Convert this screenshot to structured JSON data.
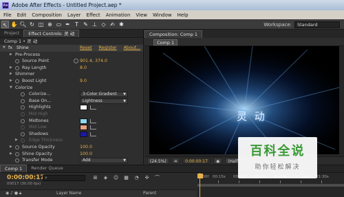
{
  "window": {
    "title": "Adobe After Effects - Untitled Project.aep *",
    "app_icon_label": "Ae"
  },
  "menu": [
    "File",
    "Edit",
    "Composition",
    "Layer",
    "Effect",
    "Animation",
    "View",
    "Window",
    "Help"
  ],
  "toolbar": {
    "tools": [
      "selection-tool",
      "hand-tool",
      "zoom-tool",
      "rotate-tool",
      "camera-tool",
      "pan-behind-tool",
      "mask-tool",
      "pen-tool",
      "text-tool",
      "brush-tool",
      "clone-tool",
      "eraser-tool",
      "roto-brush-tool",
      "puppet-tool"
    ],
    "workspace_label": "Workspace:",
    "workspace_value": "Standard"
  },
  "left_panel": {
    "tabs": [
      "Project",
      "Effect Controls: 灵 动"
    ],
    "subheader": "Comp 1 • 灵 动",
    "effect": {
      "name": "Shine",
      "links": [
        "Reset",
        "Register",
        "About..."
      ]
    },
    "rows": [
      {
        "label": "Pre-Process",
        "value": ""
      },
      {
        "label": "Source Point",
        "value": "901.4, 374.0"
      },
      {
        "label": "Ray Length",
        "value": "8.0"
      },
      {
        "label": "Shimmer",
        "value": ""
      },
      {
        "label": "Boost Light",
        "value": "9.0"
      },
      {
        "label": "Colorize",
        "value": ""
      },
      {
        "label": "Colorize...",
        "value": "3-Color Gradient"
      },
      {
        "label": "Base On...",
        "value": "Lightness"
      },
      {
        "label": "Highlights",
        "value": ""
      },
      {
        "label": "Mid High",
        "value": ""
      },
      {
        "label": "Midtones",
        "value": ""
      },
      {
        "label": "Mid Low",
        "value": ""
      },
      {
        "label": "Shadows",
        "value": ""
      },
      {
        "label": "Edge Thickness",
        "value": ""
      },
      {
        "label": "Source Opacity",
        "value": "100.0"
      },
      {
        "label": "Shine Opacity",
        "value": "100.0"
      },
      {
        "label": "Transfer Mode",
        "value": "Add"
      }
    ],
    "colors": {
      "highlights": "#ffffff",
      "midtones": "#8fd8f0",
      "mid_low": "#e8a080",
      "shadows": "#1a1aa8"
    }
  },
  "composition": {
    "tab": "Composition: Comp 1",
    "sub_tab": "Comp 1",
    "viewer_text": "灵 动",
    "viewer_bar": {
      "zoom": "(24.5%)",
      "timecode": "0:00:00:17",
      "resolution": "(Half)"
    }
  },
  "timeline": {
    "tabs": [
      "Comp 1",
      "Render Queue"
    ],
    "timecode": "0:00:00:17",
    "fps": "00017 (30.00 fps)",
    "columns": [
      "Layer Name",
      "Parent"
    ],
    "ruler_labels": [
      "0:00f",
      "00:15s",
      "00:30s",
      "00:45s",
      "01:00s",
      "01:15s",
      "01:30s"
    ]
  },
  "watermark": {
    "logo": "百科全说",
    "tagline": "助你轻松解决"
  }
}
